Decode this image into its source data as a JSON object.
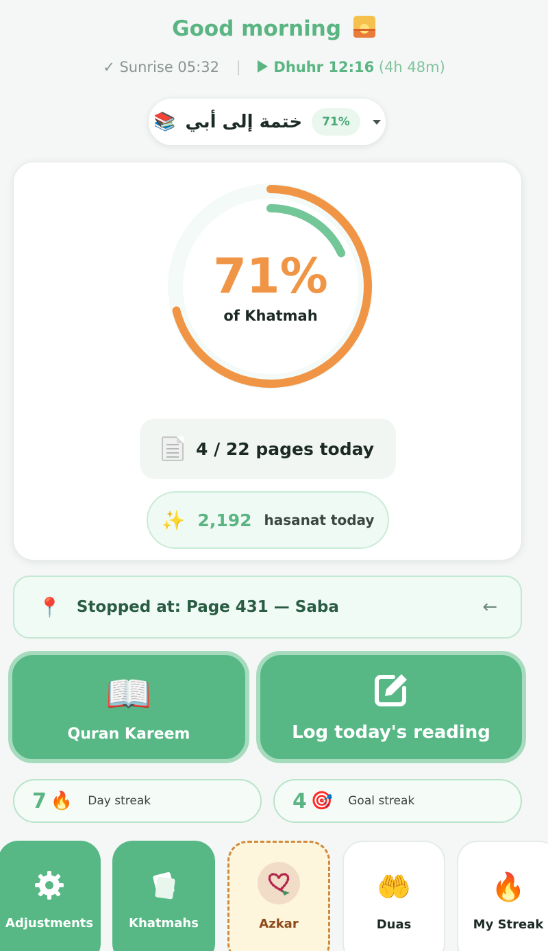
{
  "header": {
    "greeting": "Good morning",
    "greeting_icon": "sunrise-icon",
    "sunrise_label": "✓ Sunrise 05:32",
    "next_prayer": "Dhuhr 12:16",
    "next_prayer_remaining": "(4h 48m)"
  },
  "khatmah_selector": {
    "icon": "books-icon",
    "name": "ختمة إلى أبي",
    "percent": "71%"
  },
  "progress": {
    "percent_label": "71%",
    "percent_value": 0.71,
    "daily_fraction": 0.18,
    "caption": "of Khatmah",
    "pages_today": "4 / 22 pages today",
    "hasanat_value": "2,192",
    "hasanat_label": "hasanat today"
  },
  "stopped": {
    "text": "Stopped at: Page 431 — Saba",
    "arrow": "←"
  },
  "actions": {
    "quran_label": "Quran Kareem",
    "log_label": "Log today's reading"
  },
  "streaks": {
    "day_value": "7",
    "day_label": "Day streak",
    "goal_value": "4",
    "goal_label": "Goal streak"
  },
  "tiles": {
    "adjustments": "Adjustments",
    "khatmahs": "Khatmahs",
    "azkar": "Azkar",
    "duas": "Duas",
    "my_streak": "My Streak"
  },
  "colors": {
    "accent_green": "#57b886",
    "ring_orange": "#ef9545",
    "ring_green": "#73c697"
  }
}
